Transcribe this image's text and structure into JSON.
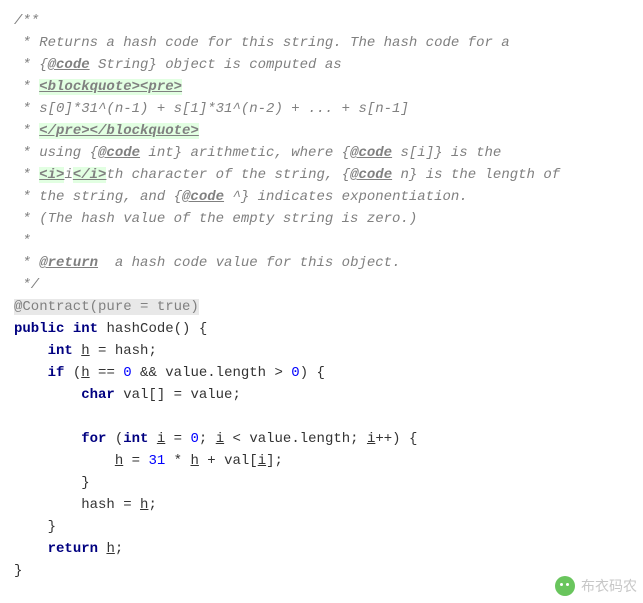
{
  "doc": {
    "open": "/**",
    "l1a": " * Returns a hash code for this string. The hash code for a",
    "l2a": " * {",
    "l2b": "@code",
    "l2c": " String} object is computed as",
    "l3a": " * ",
    "l3b": "<blockquote><pre>",
    "l4": " * s[0]*31^(n-1) + s[1]*31^(n-2) + ... + s[n-1]",
    "l5a": " * ",
    "l5b": "</pre></blockquote>",
    "l6a": " * using {",
    "l6b": "@code",
    "l6c": " int} arithmetic, where {",
    "l6d": "@code",
    "l6e": " s[i]} is the",
    "l7a": " * ",
    "l7b": "<i>",
    "l7c": "i",
    "l7d": "</i>",
    "l7e": "th character of the string, {",
    "l7f": "@code",
    "l7g": " n} is the length of",
    "l8a": " * the string, and {",
    "l8b": "@code",
    "l8c": " ^} indicates exponentiation.",
    "l9": " * (The hash value of the empty string is zero.)",
    "star": " *",
    "l10a": " * ",
    "l10b": "@return",
    "l10c": "  a hash code value for this object.",
    "close": " */"
  },
  "annotation": "@Contract(pure = true)",
  "code": {
    "kw_public": "public",
    "kw_int": "int",
    "fn": " hashCode() {",
    "kw_int2": "int",
    "h": "h",
    "eq_hash": " = hash;",
    "kw_if": "if",
    "if_open": " (",
    "eq0": " == ",
    "zero": "0",
    "andand": " && value.length > ",
    "zero2": "0",
    "if_close": ") {",
    "kw_char": "char",
    "val_decl": " val[] = value;",
    "kw_for": "for",
    "for_open": " (",
    "kw_int3": "int",
    "i": "i",
    "eq": " = ",
    "zero3": "0",
    "semi": "; ",
    "lt": " < value.length; ",
    "pp": "++) {",
    "assign_h": " = ",
    "thirtyone": "31",
    "times": " * ",
    "plus_val": " + val[",
    "close_idx": "];",
    "brace_close": "}",
    "hash_eq": "hash = ",
    "semicolon": ";",
    "kw_return": "return",
    "ret_end": ";"
  },
  "watermark": "布衣码农"
}
